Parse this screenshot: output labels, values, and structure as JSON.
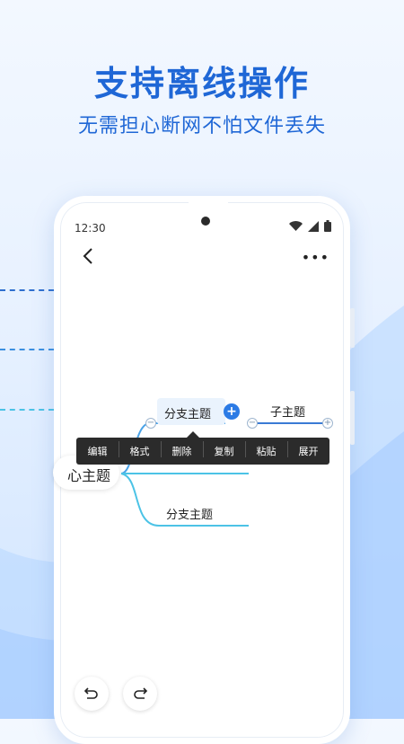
{
  "headline": "支持离线操作",
  "subline": "无需担心断网不怕文件丢失",
  "colors": {
    "brand": "#1f67d6",
    "accent": "#2c7be5",
    "branch_line": "#4cc3e6",
    "menu_bg": "#2b2b2b"
  },
  "status_bar": {
    "time": "12:30",
    "icons": [
      "wifi-icon",
      "signal-icon",
      "battery-icon"
    ]
  },
  "toolbar": {
    "back_icon": "chevron-left-icon",
    "more_icon": "more-dots-icon"
  },
  "mindmap": {
    "root_label": "心主题",
    "branch_selected": "分支主题",
    "child": "子主题",
    "branch_second": "分支主题"
  },
  "context_menu": {
    "items": [
      "编辑",
      "格式",
      "删除",
      "复制",
      "粘贴",
      "展开"
    ]
  },
  "bottom": {
    "undo_icon": "undo-icon",
    "redo_icon": "redo-icon"
  }
}
